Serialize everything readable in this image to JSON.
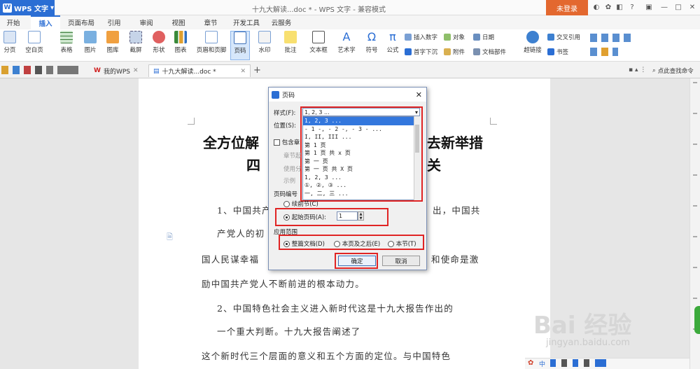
{
  "app": {
    "name": "WPS 文字",
    "doc_title": "十九大解读...doc * - WPS 文字 - 兼容模式",
    "login": "未登录"
  },
  "menu": [
    "开始",
    "插入",
    "页面布局",
    "引用",
    "审阅",
    "视图",
    "章节",
    "开发工具",
    "云服务"
  ],
  "ribbon": {
    "items": [
      "分页",
      "空白页",
      "表格",
      "图片",
      "图库",
      "截屏",
      "形状",
      "图表",
      "页眉和页脚",
      "页码",
      "水印",
      "批注",
      "文本框",
      "艺术字",
      "符号",
      "公式"
    ],
    "small": [
      "插入数字",
      "对象",
      "日期",
      "首字下沉",
      "附件",
      "文档部件",
      "超链接",
      "交叉引用",
      "书签"
    ]
  },
  "doctabs": {
    "home": "我的WPS",
    "file": "十九大解读...doc *",
    "search": "点此查找命令"
  },
  "doc": {
    "title1_left": "全方位解",
    "title1_right": "去新举措",
    "title2_left": "四",
    "title2_right": "关",
    "p1a": "1、中国共产",
    "p1a_r": "出，中国共",
    "p1b": "产党人的初",
    "p2a": "国人民谋幸福",
    "p2a_r": "和使命是激",
    "p2b": "励中国共产党人不断前进的根本动力。",
    "p3a": "2、中国特色社会主义进入新时代这是十九大报告作出的",
    "p3b": "一个重大判断。十九大报告阐述了",
    "p4": "这个新时代三个层面的意义和五个方面的定位。与中国特色"
  },
  "dialog": {
    "title": "页码",
    "style_label": "样式(F):",
    "style_value": "1, 2, 3 ...",
    "position_label": "位置(S):",
    "include_chapter": "包含章",
    "chapter_start": "章节起",
    "use_sep": "使用分",
    "example": "示例",
    "numbering_label": "页码编号",
    "continue": "续前节(C)",
    "start_at_label": "起始页码(A):",
    "start_at_value": "1",
    "apply_label": "应用范围",
    "apply_whole": "整篇文档(D)",
    "apply_after": "本页及之后(E)",
    "apply_section": "本节(T)",
    "ok": "确定",
    "cancel": "取消",
    "styles": [
      "1, 2, 3 ...",
      "- 1 -, - 2 -, - 3 - ...",
      "I, II, III ...",
      "第 1 页",
      "第 1 页 共 x 页",
      "第 一 页",
      "第 一 页 共 X 页",
      "1, 2, 3 ...",
      "①, ②, ③ ...",
      "一, 二, 三 ..."
    ]
  },
  "watermark": {
    "brand": "Bai 经验",
    "url": "jingyan.baidu.com"
  }
}
